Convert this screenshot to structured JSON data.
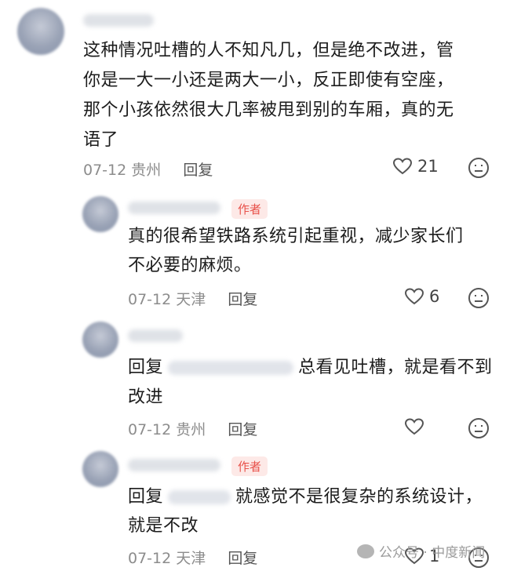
{
  "comments": [
    {
      "lines": [
        "这种情况吐槽的人不知凡几，但是绝不改进，管",
        "你是一大一小还是两大一小，反正即使有空座，",
        "那个小孩依然很大几率被甩到别的车厢，真的无",
        "语了"
      ],
      "date": "07-12",
      "location": "贵州",
      "reply_label": "回复",
      "likes": "21"
    },
    {
      "author_tag": "作者",
      "lines": [
        "真的很希望铁路系统引起重视，减少家长们",
        "不必要的麻烦。"
      ],
      "date": "07-12",
      "location": "天津",
      "reply_label": "回复",
      "likes": "6"
    },
    {
      "prefix": "回复",
      "lines_first": "总看见吐槽，就是看不到",
      "lines_second": "改进",
      "date": "07-12",
      "location": "贵州",
      "reply_label": "回复",
      "likes": ""
    },
    {
      "author_tag": "作者",
      "prefix": "回复",
      "lines_first": "就感觉不是很复杂的系统设计，",
      "lines_second": "就是不改",
      "date": "07-12",
      "location": "天津",
      "reply_label": "回复",
      "likes": "1"
    }
  ],
  "watermark": "公众号 · 中度新闻",
  "icons": {
    "like": "heart-outline-icon",
    "emoji": "smiley-icon"
  }
}
